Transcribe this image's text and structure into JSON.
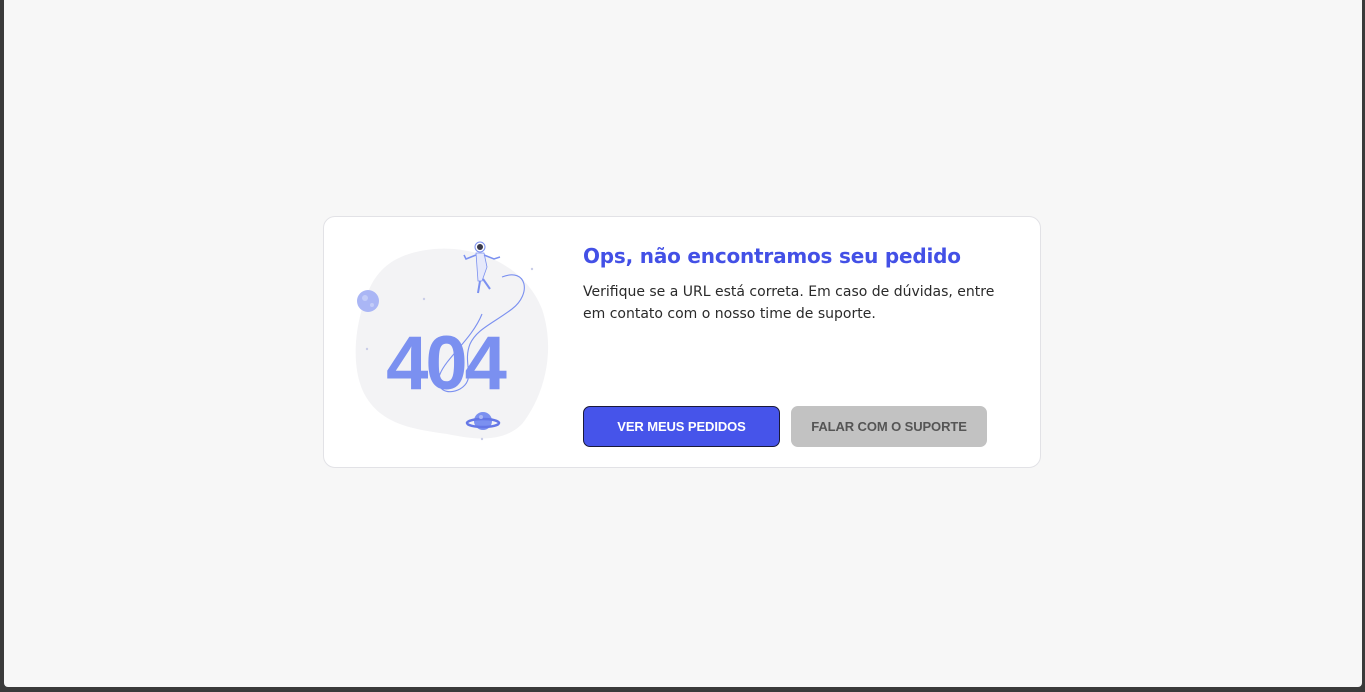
{
  "error": {
    "code": "404",
    "title": "Ops, não encontramos seu pedido",
    "description": "Verifique se a URL está correta. Em caso de dúvidas, entre em contato com o nosso time de suporte."
  },
  "actions": {
    "primary_label": "VER MEUS PEDIDOS",
    "secondary_label": "FALAR COM O SUPORTE"
  },
  "colors": {
    "accent": "#4654ea",
    "illustration": "#7b90f0",
    "secondary_button": "#c2c2c2",
    "page_background": "#f7f7f7"
  }
}
